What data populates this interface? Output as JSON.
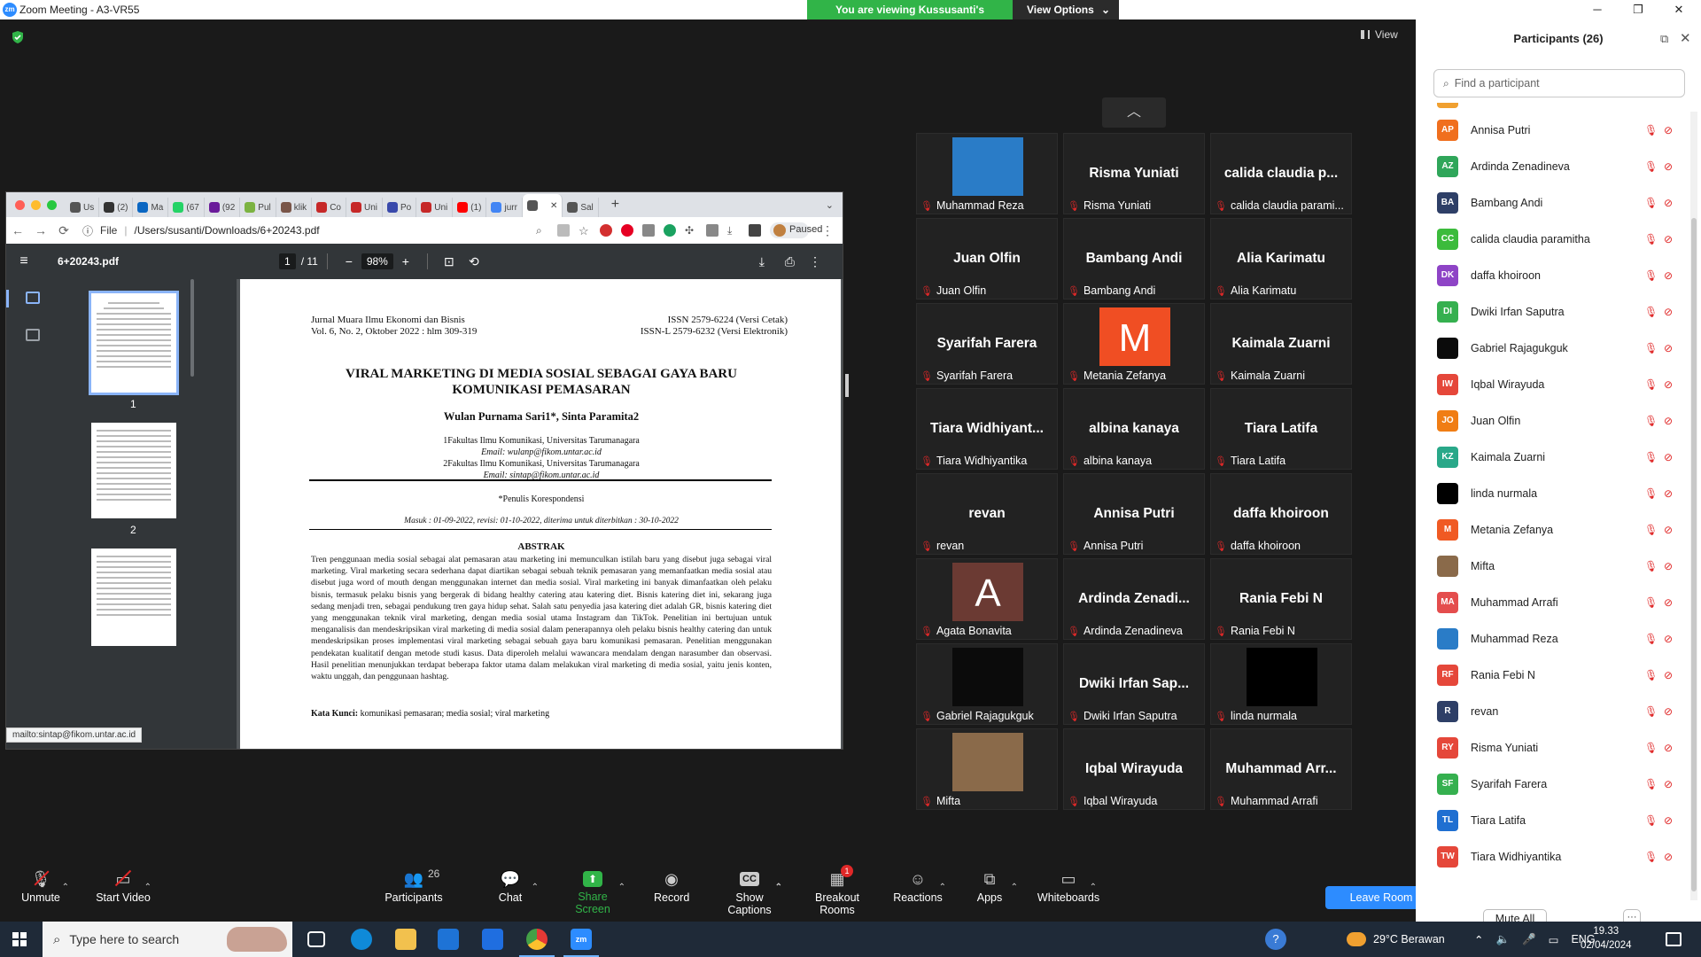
{
  "window": {
    "title": "Zoom Meeting - A3-VR55",
    "share_banner": "You are viewing Kussusanti's screen",
    "view_options": "View Options"
  },
  "meeting": {
    "view_label": "View"
  },
  "browser": {
    "tabs": [
      {
        "label": "Us",
        "color": "#555555"
      },
      {
        "label": "(2)",
        "color": "#333333"
      },
      {
        "label": "Ma",
        "color": "#0a66c2"
      },
      {
        "label": "(67",
        "color": "#25d366"
      },
      {
        "label": "(92",
        "color": "#6a1b9a"
      },
      {
        "label": "Pul",
        "color": "#7cb342"
      },
      {
        "label": "klik",
        "color": "#795548"
      },
      {
        "label": "Co",
        "color": "#c62828"
      },
      {
        "label": "Uni",
        "color": "#c62828"
      },
      {
        "label": "Po",
        "color": "#3949ab"
      },
      {
        "label": "Uni",
        "color": "#c62828"
      },
      {
        "label": "(1)",
        "color": "#ff0000"
      },
      {
        "label": "jurr",
        "color": "#4285f4"
      },
      {
        "label": "",
        "color": "#555555",
        "active": true
      },
      {
        "label": "Sal",
        "color": "#555555"
      }
    ],
    "file_label": "File",
    "url": "/Users/susanti/Downloads/6+20243.pdf",
    "paused_label": "Paused",
    "pdf": {
      "filename": "6+20243.pdf",
      "page_current": "1",
      "page_total": "/ 11",
      "zoom": "98%",
      "thumb_labels": [
        "1",
        "2"
      ],
      "hover_link": "mailto:sintap@fikom.untar.ac.id"
    },
    "paper": {
      "journal_line1": "Jurnal Muara Ilmu Ekonomi dan Bisnis",
      "journal_line2": "Vol. 6, No. 2, Oktober 2022 : hlm 309-319",
      "issn_line1": "ISSN   2579-6224 (Versi Cetak)",
      "issn_line2": "ISSN-L   2579-6232 (Versi Elektronik)",
      "title_line1": "VIRAL MARKETING DI MEDIA SOSIAL SEBAGAI GAYA BARU",
      "title_line2": "KOMUNIKASI PEMASARAN",
      "authors": "Wulan Purnama Sari1*, Sinta Paramita2",
      "affil1": "1Fakultas Ilmu Komunikasi, Universitas Tarumanagara",
      "email1": "Email: wulanp@fikom.untar.ac.id",
      "affil2": "2Fakultas Ilmu Komunikasi, Universitas Tarumanagara",
      "email2": "Email: sintap@fikom.untar.ac.id",
      "corresponding": "*Penulis Korespondensi",
      "dates": "Masuk : 01-09-2022, revisi: 01-10-2022, diterima untuk diterbitkan : 30-10-2022",
      "abstract_heading": "ABSTRAK",
      "abstract": "Tren penggunaan media sosial sebagai alat pemasaran atau marketing ini memunculkan istilah baru yang disebut juga sebagai viral marketing. Viral marketing secara sederhana dapat diartikan sebagai sebuah teknik pemasaran yang memanfaatkan media sosial atau disebut juga word of mouth dengan menggunakan internet dan media sosial. Viral marketing ini banyak dimanfaatkan oleh pelaku bisnis, termasuk pelaku bisnis yang bergerak di bidang healthy catering atau katering diet. Bisnis katering diet ini, sekarang juga sedang menjadi tren, sebagai pendukung tren gaya hidup sehat. Salah satu penyedia jasa katering diet adalah GR, bisnis katering diet yang menggunakan teknik viral marketing, dengan media sosial utama Instagram dan TikTok. Penelitian ini bertujuan untuk menganalisis dan mendeskripsikan viral marketing di media sosial dalam penerapannya oleh pelaku bisnis healthy catering dan untuk mendeskripsikan proses implementasi viral marketing sebagai sebuah gaya baru komunikasi pemasaran. Penelitian menggunakan pendekatan kualitatif dengan metode studi kasus. Data diperoleh melalui wawancara mendalam dengan narasumber dan observasi. Hasil penelitian menunjukkan terdapat beberapa faktor utama dalam melakukan viral marketing di media sosial, yaitu jenis konten, waktu unggah, dan penggunaan hashtag.",
      "keywords_label": "Kata Kunci:",
      "keywords": " komunikasi pemasaran; media sosial; viral marketing"
    }
  },
  "gallery": [
    {
      "display": "",
      "name": "Muhammad Reza",
      "kind": "video",
      "color": "#2a7cc7"
    },
    {
      "display": "Risma Yuniati",
      "name": "Risma Yuniati",
      "kind": "name"
    },
    {
      "display": "calida claudia p...",
      "name": "calida claudia parami...",
      "kind": "name"
    },
    {
      "display": "Juan Olfin",
      "name": "Juan Olfin",
      "kind": "name"
    },
    {
      "display": "Bambang Andi",
      "name": "Bambang Andi",
      "kind": "name"
    },
    {
      "display": "Alia Karimatu",
      "name": "Alia Karimatu",
      "kind": "name"
    },
    {
      "display": "Syarifah Farera",
      "name": "Syarifah Farera",
      "kind": "name"
    },
    {
      "display": "M",
      "name": "Metania Zefanya",
      "kind": "letter",
      "color": "#f04e23"
    },
    {
      "display": "Kaimala Zuarni",
      "name": "Kaimala Zuarni",
      "kind": "name"
    },
    {
      "display": "Tiara  Widhiyant...",
      "name": "Tiara Widhiyantika",
      "kind": "name"
    },
    {
      "display": "albina kanaya",
      "name": "albina kanaya",
      "kind": "name"
    },
    {
      "display": "Tiara Latifa",
      "name": "Tiara Latifa",
      "kind": "name"
    },
    {
      "display": "revan",
      "name": "revan",
      "kind": "name"
    },
    {
      "display": "Annisa Putri",
      "name": "Annisa Putri",
      "kind": "name"
    },
    {
      "display": "daffa khoiroon",
      "name": "daffa khoiroon",
      "kind": "name"
    },
    {
      "display": "A",
      "name": "Agata Bonavita",
      "kind": "letter",
      "color": "#6b3a33"
    },
    {
      "display": "Ardinda  Zenadi...",
      "name": "Ardinda Zenadineva",
      "kind": "name"
    },
    {
      "display": "Rania Febi N",
      "name": "Rania Febi N",
      "kind": "name"
    },
    {
      "display": "",
      "name": "Gabriel Rajagukguk",
      "kind": "video",
      "color": "#0b0b0b"
    },
    {
      "display": "Dwiki  Irfan Sap...",
      "name": "Dwiki Irfan Saputra",
      "kind": "name"
    },
    {
      "display": "",
      "name": "linda nurmala",
      "kind": "video",
      "color": "#000000"
    },
    {
      "display": "",
      "name": "Mifta",
      "kind": "video",
      "color": "#8a6a4a"
    },
    {
      "display": "Iqbal Wirayuda",
      "name": "Iqbal Wirayuda",
      "kind": "name"
    },
    {
      "display": "Muhammad  Arr...",
      "name": "Muhammad Arrafi",
      "kind": "name"
    }
  ],
  "toolbar": {
    "unmute": "Unmute",
    "start_video": "Start Video",
    "participants": "Participants",
    "participants_count": "26",
    "chat": "Chat",
    "share_screen": "Share Screen",
    "record": "Record",
    "captions": "Show Captions",
    "breakout": "Breakout Rooms",
    "breakout_badge": "1",
    "reactions": "Reactions",
    "apps": "Apps",
    "whiteboards": "Whiteboards",
    "leave": "Leave Room"
  },
  "panel": {
    "title": "Participants (26)",
    "search_placeholder": "Find a participant",
    "mute_all": "Mute All",
    "more": "···",
    "participants": [
      {
        "initials": "AP",
        "name": "Annisa Putri",
        "color": "#f06f1e"
      },
      {
        "initials": "AZ",
        "name": "Ardinda Zenadineva",
        "color": "#2fa65a"
      },
      {
        "initials": "BA",
        "name": "Bambang Andi",
        "color": "#2e3f67"
      },
      {
        "initials": "CC",
        "name": "calida claudia paramitha",
        "color": "#3cbb3c"
      },
      {
        "initials": "DK",
        "name": "daffa khoiroon",
        "color": "#8e44c6"
      },
      {
        "initials": "DI",
        "name": "Dwiki Irfan Saputra",
        "color": "#35b04f"
      },
      {
        "initials": "",
        "name": "Gabriel Rajagukguk",
        "color": "#0b0b0b"
      },
      {
        "initials": "IW",
        "name": "Iqbal Wirayuda",
        "color": "#e5473a"
      },
      {
        "initials": "JO",
        "name": "Juan Olfin",
        "color": "#f07d14"
      },
      {
        "initials": "KZ",
        "name": "Kaimala Zuarni",
        "color": "#29a889"
      },
      {
        "initials": "",
        "name": "linda nurmala",
        "color": "#000000"
      },
      {
        "initials": "M",
        "name": "Metania Zefanya",
        "color": "#f05a23"
      },
      {
        "initials": "",
        "name": "Mifta",
        "color": "#8a6a4a"
      },
      {
        "initials": "MA",
        "name": "Muhammad Arrafi",
        "color": "#e44d4d"
      },
      {
        "initials": "",
        "name": "Muhammad Reza",
        "color": "#2a7cc7"
      },
      {
        "initials": "RF",
        "name": "Rania Febi N",
        "color": "#e5473a"
      },
      {
        "initials": "R",
        "name": "revan",
        "color": "#2e3f67"
      },
      {
        "initials": "RY",
        "name": "Risma Yuniati",
        "color": "#e5473a"
      },
      {
        "initials": "SF",
        "name": "Syarifah Farera",
        "color": "#35b04f"
      },
      {
        "initials": "TL",
        "name": "Tiara Latifa",
        "color": "#1f6fd1"
      },
      {
        "initials": "TW",
        "name": "Tiara Widhiyantika",
        "color": "#e5473a"
      }
    ]
  },
  "taskbar": {
    "search_placeholder": "Type here to search",
    "weather": "29°C  Berawan",
    "lang": "ENG",
    "time": "19.33",
    "date": "02/04/2024"
  }
}
